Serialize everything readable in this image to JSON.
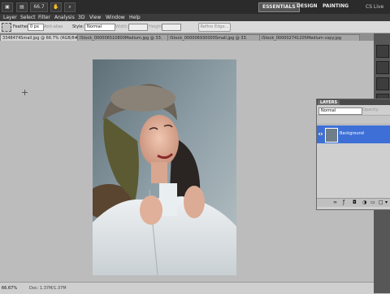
{
  "appbar": {
    "ps_logo": "Ps",
    "zoom": "66.7",
    "workspaces": [
      "ESSENTIALS",
      "DESIGN",
      "PAINTING"
    ],
    "cslive": "CS Live"
  },
  "menu": [
    "Layer",
    "Select",
    "Filter",
    "Analysis",
    "3D",
    "View",
    "Window",
    "Help"
  ],
  "options": {
    "feather_label": "Feather:",
    "feather_value": "0 px",
    "antialias": "Anti-alias",
    "style_label": "Style:",
    "style_value": "Normal",
    "width_label": "Width:",
    "height_label": "Height:",
    "refine_edge": "Refine Edge..."
  },
  "tabs": [
    "3348474Small.jpg @ 66.7% (RGB/8#) ×",
    "iStock_000006510800Medium.jpg @ 33.",
    "iStock_000006930000Small.jpg @ 33.",
    "iStock_000002741205Medium copy.jpg"
  ],
  "layers": {
    "tab": "LAYERS",
    "blend_mode": "Normal",
    "opacity_label": "Opacity:",
    "layer_name": "Background"
  },
  "status": {
    "zoom": "66.67%",
    "doc": "Doc: 1.37M/1.37M"
  },
  "colors": {
    "appbar": "#2b2b2b",
    "selected_layer": "#3e6fd6"
  }
}
